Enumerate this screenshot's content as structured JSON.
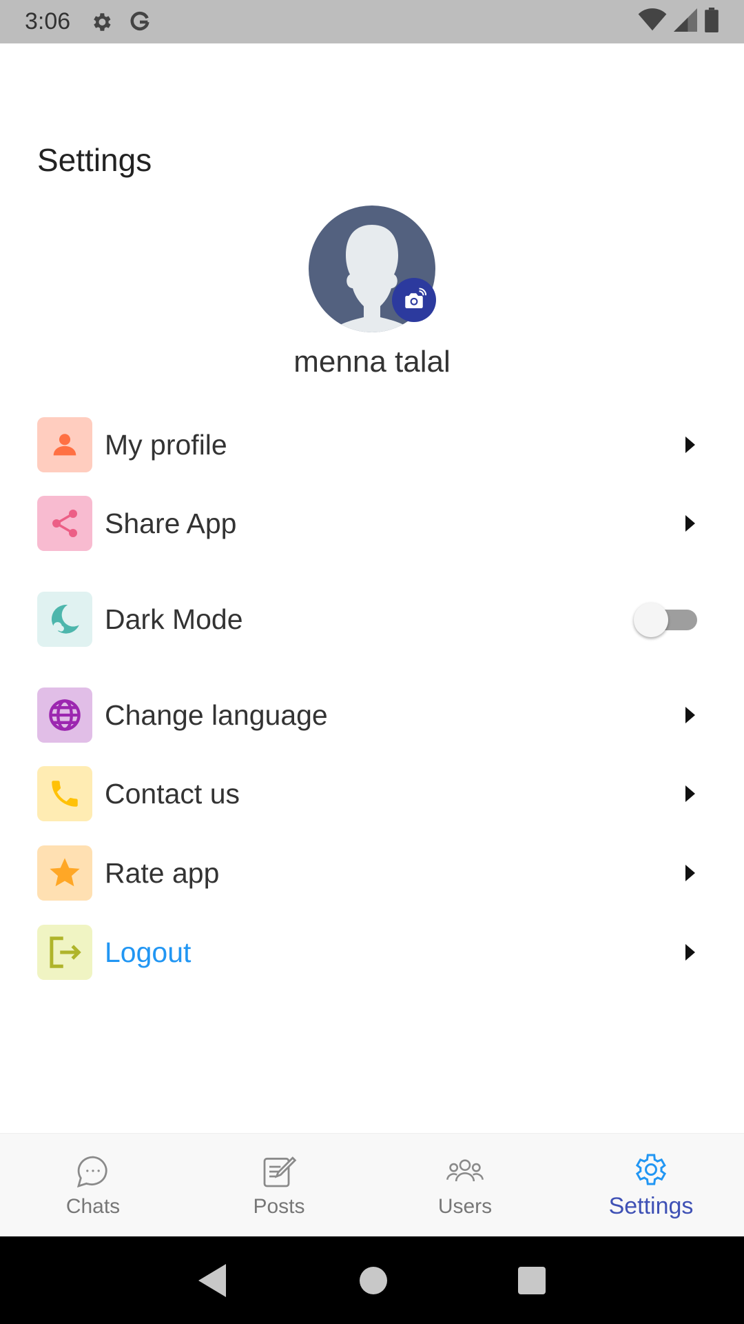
{
  "status_bar": {
    "time": "3:06",
    "icons": [
      "gear-icon",
      "google-icon",
      "wifi-icon",
      "signal-icon",
      "battery-icon"
    ]
  },
  "page": {
    "title": "Settings"
  },
  "profile": {
    "name": "menna talal",
    "avatar_color": "#53617f",
    "badge_color": "#2c3a9e"
  },
  "menu": {
    "items": [
      {
        "label": "My profile",
        "icon": "person-icon",
        "icon_bg": "#ffcdbf",
        "icon_color": "#ff7043"
      },
      {
        "label": "Share App",
        "icon": "share-icon",
        "icon_bg": "#f8bbd0",
        "icon_color": "#ec5f86"
      },
      {
        "label": "Dark Mode",
        "icon": "moon-icon",
        "icon_bg": "#e0f2f1",
        "icon_color": "#4db6ac",
        "toggle": false
      },
      {
        "label": "Change language",
        "icon": "globe-icon",
        "icon_bg": "#e1bee7",
        "icon_color": "#9c27b0"
      },
      {
        "label": "Contact us",
        "icon": "phone-icon",
        "icon_bg": "#ffecb3",
        "icon_color": "#ffc107"
      },
      {
        "label": "Rate app",
        "icon": "star-icon",
        "icon_bg": "#ffe0b2",
        "icon_color": "#ffa726"
      },
      {
        "label": "Logout",
        "icon": "logout-icon",
        "icon_bg": "#f0f4c3",
        "icon_color": "#afb42b",
        "text_color": "#2196f3"
      }
    ]
  },
  "bottom_nav": {
    "tabs": [
      {
        "label": "Chats",
        "icon": "chat-bubble-icon"
      },
      {
        "label": "Posts",
        "icon": "posts-edit-icon"
      },
      {
        "label": "Users",
        "icon": "users-icon"
      },
      {
        "label": "Settings",
        "icon": "settings-gear-icon",
        "active": true
      }
    ],
    "active_color": "#3f51b5"
  },
  "system_nav": {
    "buttons": [
      "back-icon",
      "home-icon",
      "recents-icon"
    ]
  }
}
